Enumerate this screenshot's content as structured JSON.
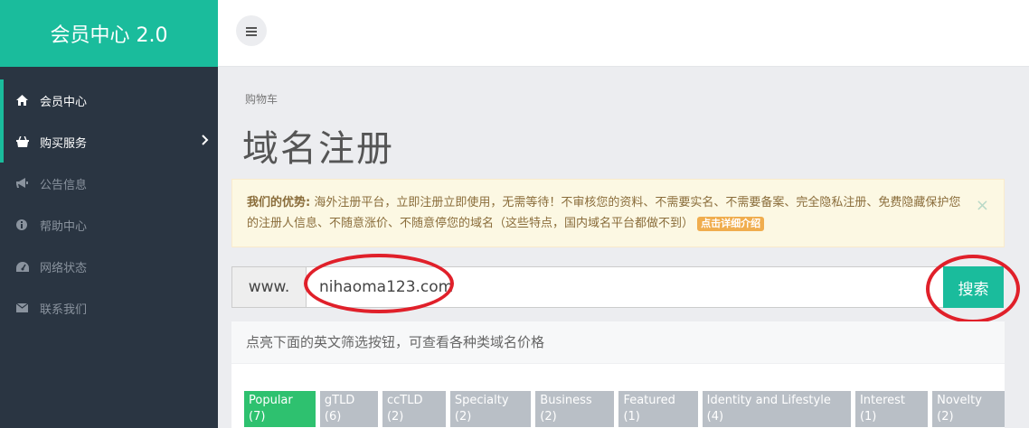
{
  "brand": {
    "title": "会员中心 2.0",
    "color": "#1abc9c"
  },
  "sidebar": {
    "items": [
      {
        "label": "会员中心",
        "icon": "home-icon",
        "active": true
      },
      {
        "label": "购买服务",
        "icon": "basket-icon",
        "active": true,
        "expandable": true
      },
      {
        "label": "公告信息",
        "icon": "bullhorn-icon"
      },
      {
        "label": "帮助中心",
        "icon": "info-icon"
      },
      {
        "label": "网络状态",
        "icon": "dashboard-icon"
      },
      {
        "label": "联系我们",
        "icon": "envelope-icon"
      }
    ]
  },
  "topbar": {
    "menu_icon": "hamburger-icon"
  },
  "breadcrumb": "购物车",
  "page_title": "域名注册",
  "alert": {
    "title": "我们的优势:",
    "text": " 海外注册平台，立即注册立即使用，无需等待！不审核您的资料、不需要实名、不需要备案、完全隐私注册、免费隐藏保护您的注册人信息、不随意涨价、不随意停您的域名（这些特点，国内域名平台都做不到）",
    "badge": "点击详细介绍",
    "close": "×"
  },
  "search": {
    "prefix": "www.",
    "value": "nihaoma123.com",
    "button": "搜索"
  },
  "filters": {
    "hint": "点亮下面的英文筛选按钮，可查看各种类域名价格",
    "tags": [
      {
        "label": "Popular (7)",
        "active": true
      },
      {
        "label": "gTLD (6)"
      },
      {
        "label": "ccTLD (2)"
      },
      {
        "label": "Specialty (2)"
      },
      {
        "label": "Business (2)"
      },
      {
        "label": "Featured (1)"
      },
      {
        "label": "Identity and Lifestyle (4)"
      },
      {
        "label": "Interest (1)"
      },
      {
        "label": "Novelty (2)"
      }
    ]
  }
}
